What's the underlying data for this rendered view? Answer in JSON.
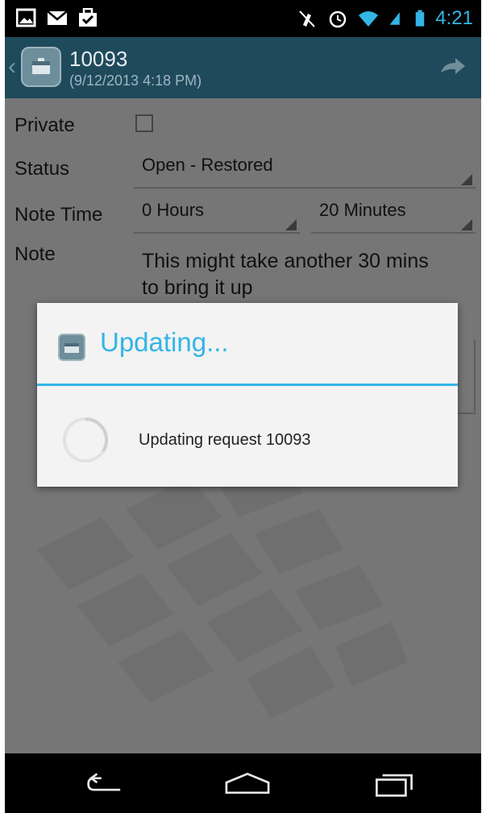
{
  "status_bar": {
    "time": "4:21",
    "left_icons": [
      "picture-icon",
      "mail-icon",
      "briefcase-check-icon"
    ],
    "right_icons": [
      "mute-icon",
      "alarm-icon",
      "wifi-icon",
      "signal-icon",
      "battery-icon"
    ]
  },
  "action_bar": {
    "title": "10093",
    "subtitle": "(9/12/2013 4:18 PM)"
  },
  "form": {
    "private_label": "Private",
    "status_label": "Status",
    "status_value": "Open - Restored",
    "note_time_label": "Note Time",
    "hours_value": "0 Hours",
    "minutes_value": "20 Minutes",
    "note_label": "Note",
    "note_value": "This might take another 30 mins to bring it up"
  },
  "dialog": {
    "title": "Updating...",
    "message": "Updating request 10093"
  },
  "colors": {
    "accent": "#33b5e5",
    "action_bar": "#1f4a5c",
    "status_bar": "#000000"
  }
}
